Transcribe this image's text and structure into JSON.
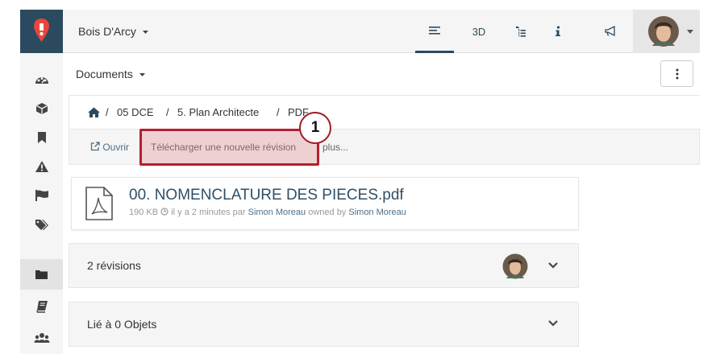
{
  "topbar": {
    "project": "Bois D'Arcy",
    "tabs": [
      {
        "icon": "list-icon"
      },
      {
        "label": "3D"
      },
      {
        "icon": "tree-icon"
      },
      {
        "icon": "info-icon"
      },
      {
        "icon": "megaphone-icon"
      }
    ]
  },
  "sidebar": {
    "items": [
      "dashboard-icon",
      "box-icon",
      "bookmark-icon",
      "warning-icon",
      "flag-icon",
      "tags-icon",
      "folder-icon",
      "book-icon",
      "users-icon"
    ],
    "active": "folder-icon"
  },
  "documents": {
    "title": "Documents"
  },
  "breadcrumb": {
    "items": [
      "05 DCE",
      "5. Plan Architecte",
      "PDF"
    ],
    "separator": "/"
  },
  "actions": {
    "open": "Ouvrir",
    "upload": "Télécharger une nouvelle révision",
    "more": "plus..."
  },
  "annotation": {
    "number": "1"
  },
  "file": {
    "name": "00. NOMENCLATURE DES PIECES.pdf",
    "size": "190 KB",
    "time": "il y a 2 minutes par",
    "author": "Simon Moreau",
    "owned_by": "owned by",
    "owner": "Simon Moreau"
  },
  "panels": {
    "revisions": "2 révisions",
    "linked": "Lié à 0 Objets"
  },
  "colors": {
    "accent": "#2b4a5f",
    "logo_pin": "#e8453c",
    "highlight": "#b51e2c"
  }
}
